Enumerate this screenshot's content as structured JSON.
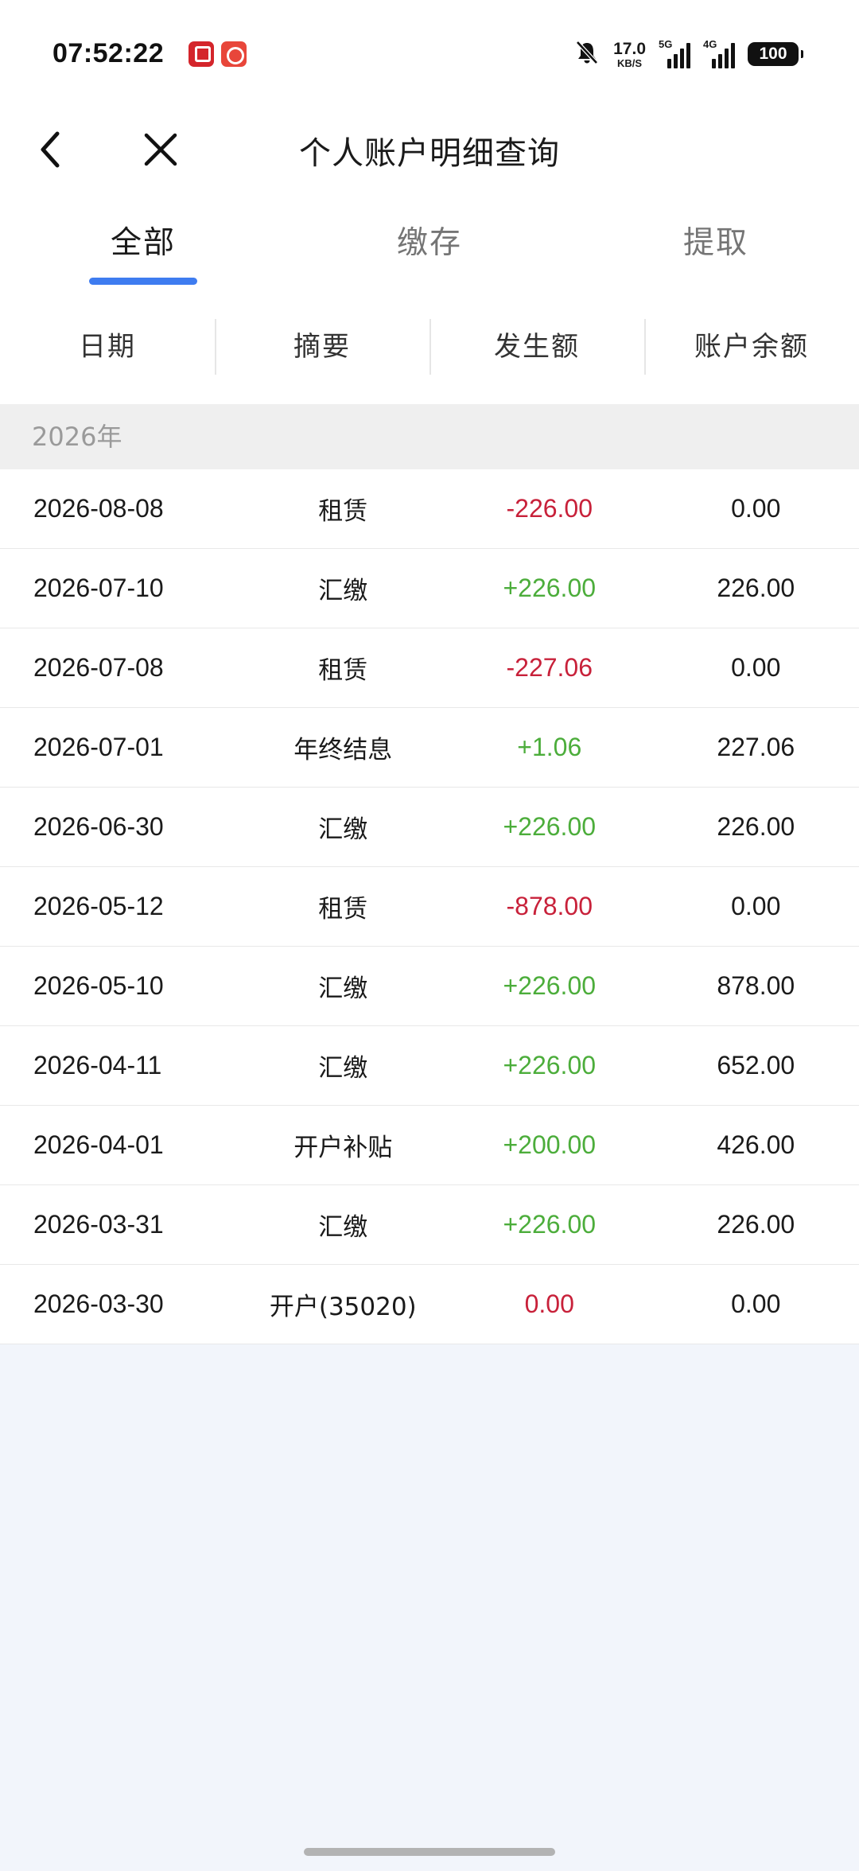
{
  "status_bar": {
    "time": "07:52:22",
    "net_speed_value": "17.0",
    "net_speed_unit": "KB/S",
    "signal1_label": "5G",
    "signal2_label": "4G",
    "battery": "100",
    "icons": [
      "app-icon-1",
      "app-icon-2",
      "mute-bell-icon",
      "signal-icon",
      "signal-icon",
      "battery-icon"
    ]
  },
  "header": {
    "title": "个人账户明细查询",
    "back_icon": "chevron-left-icon",
    "close_icon": "close-icon"
  },
  "tabs": [
    {
      "label": "全部",
      "active": true
    },
    {
      "label": "缴存",
      "active": false
    },
    {
      "label": "提取",
      "active": false
    }
  ],
  "columns": [
    "日期",
    "摘要",
    "发生额",
    "账户余额"
  ],
  "year_group": "2026年",
  "records": [
    {
      "date": "2026-08-08",
      "summary": "租赁",
      "amount": "-226.00",
      "balance": "0.00",
      "type": "neg"
    },
    {
      "date": "2026-07-10",
      "summary": "汇缴",
      "amount": "+226.00",
      "balance": "226.00",
      "type": "pos"
    },
    {
      "date": "2026-07-08",
      "summary": "租赁",
      "amount": "-227.06",
      "balance": "0.00",
      "type": "neg"
    },
    {
      "date": "2026-07-01",
      "summary": "年终结息",
      "amount": "+1.06",
      "balance": "227.06",
      "type": "pos"
    },
    {
      "date": "2026-06-30",
      "summary": "汇缴",
      "amount": "+226.00",
      "balance": "226.00",
      "type": "pos"
    },
    {
      "date": "2026-05-12",
      "summary": "租赁",
      "amount": "-878.00",
      "balance": "0.00",
      "type": "neg"
    },
    {
      "date": "2026-05-10",
      "summary": "汇缴",
      "amount": "+226.00",
      "balance": "878.00",
      "type": "pos"
    },
    {
      "date": "2026-04-11",
      "summary": "汇缴",
      "amount": "+226.00",
      "balance": "652.00",
      "type": "pos"
    },
    {
      "date": "2026-04-01",
      "summary": "开户补贴",
      "amount": "+200.00",
      "balance": "426.00",
      "type": "pos"
    },
    {
      "date": "2026-03-31",
      "summary": "汇缴",
      "amount": "+226.00",
      "balance": "226.00",
      "type": "pos"
    },
    {
      "date": "2026-03-30",
      "summary": "开户(35020)",
      "amount": "0.00",
      "balance": "0.00",
      "type": "neg"
    }
  ],
  "colors": {
    "accent": "#3e7cf0",
    "negative": "#c8213a",
    "positive": "#4cad3b",
    "background": "#f2f5fb"
  }
}
